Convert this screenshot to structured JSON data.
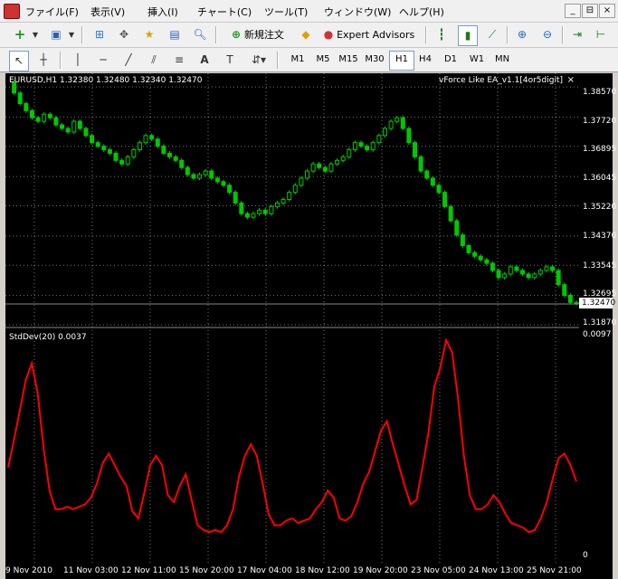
{
  "menu": [
    "ファイル(F)",
    "表示(V)",
    "挿入(I)",
    "チャート(C)",
    "ツール(T)",
    "ウィンドウ(W)",
    "ヘルプ(H)"
  ],
  "window_buttons": [
    "_",
    "⊟",
    "×"
  ],
  "toolbar": {
    "new_order": "新規注文",
    "expert_advisors": "Expert Advisors"
  },
  "timeframes": [
    "M1",
    "M5",
    "M15",
    "M30",
    "H1",
    "H4",
    "D1",
    "W1",
    "MN"
  ],
  "active_timeframe": "H1",
  "chart": {
    "header": "EURUSD,H1  1.32380 1.32480 1.32340 1.32470",
    "ea_label": "vForce Like EA_v1.1[4or5digit]",
    "ea_close": "×",
    "current_price": "1.32470",
    "price_axis": [
      "1.38570",
      "1.37720",
      "1.36895",
      "1.36045",
      "1.35220",
      "1.34370",
      "1.33545",
      "1.32695",
      "1.31870"
    ],
    "indicator_label": "StdDev(20) 0.0037",
    "indicator_axis": [
      "0.0097",
      "0"
    ],
    "time_axis": [
      "9 Nov 2010",
      "11 Nov 03:00",
      "12 Nov 11:00",
      "15 Nov 20:00",
      "17 Nov 04:00",
      "18 Nov 12:00",
      "19 Nov 20:00",
      "23 Nov 05:00",
      "24 Nov 13:00",
      "25 Nov 21:00"
    ],
    "colors": {
      "candle": "#00c800",
      "indicator": "#ff0000",
      "grid": "#ffffff",
      "background": "#000000"
    }
  },
  "chart_data": {
    "type": "line",
    "title": "EURUSD,H1",
    "series": [
      {
        "name": "EURUSD",
        "values": [
          1.387,
          1.384,
          1.381,
          1.379,
          1.377,
          1.376,
          1.378,
          1.377,
          1.375,
          1.374,
          1.373,
          1.376,
          1.374,
          1.372,
          1.37,
          1.369,
          1.368,
          1.367,
          1.365,
          1.364,
          1.366,
          1.368,
          1.37,
          1.372,
          1.371,
          1.369,
          1.367,
          1.366,
          1.365,
          1.363,
          1.361,
          1.36,
          1.361,
          1.362,
          1.36,
          1.359,
          1.358,
          1.356,
          1.353,
          1.35,
          1.349,
          1.35,
          1.351,
          1.35,
          1.352,
          1.353,
          1.354,
          1.356,
          1.358,
          1.36,
          1.362,
          1.364,
          1.363,
          1.362,
          1.364,
          1.365,
          1.366,
          1.368,
          1.37,
          1.369,
          1.368,
          1.37,
          1.372,
          1.374,
          1.376,
          1.377,
          1.374,
          1.37,
          1.366,
          1.362,
          1.36,
          1.358,
          1.356,
          1.352,
          1.348,
          1.344,
          1.341,
          1.339,
          1.338,
          1.337,
          1.336,
          1.334,
          1.332,
          1.333,
          1.335,
          1.334,
          1.333,
          1.332,
          1.333,
          1.334,
          1.335,
          1.334,
          1.33,
          1.327,
          1.325,
          1.3247
        ]
      },
      {
        "name": "StdDev(20)",
        "values": [
          0.004,
          0.0052,
          0.0065,
          0.0078,
          0.0085,
          0.0072,
          0.0048,
          0.003,
          0.0022,
          0.0022,
          0.0023,
          0.0022,
          0.0023,
          0.0024,
          0.0027,
          0.0033,
          0.0042,
          0.0046,
          0.0041,
          0.0036,
          0.0032,
          0.0021,
          0.0018,
          0.0029,
          0.0041,
          0.0045,
          0.0041,
          0.0028,
          0.0025,
          0.0032,
          0.0037,
          0.0026,
          0.0015,
          0.0013,
          0.0012,
          0.0013,
          0.0012,
          0.0015,
          0.0022,
          0.0036,
          0.0045,
          0.005,
          0.0045,
          0.0033,
          0.002,
          0.0015,
          0.0015,
          0.0017,
          0.0018,
          0.0016,
          0.0017,
          0.0018,
          0.0022,
          0.0025,
          0.003,
          0.0027,
          0.0018,
          0.0017,
          0.0019,
          0.0025,
          0.0033,
          0.0038,
          0.0047,
          0.0056,
          0.006,
          0.005,
          0.0041,
          0.0032,
          0.0024,
          0.0026,
          0.004,
          0.0055,
          0.0075,
          0.0083,
          0.0095,
          0.009,
          0.007,
          0.0045,
          0.0028,
          0.0022,
          0.0022,
          0.0024,
          0.0028,
          0.0025,
          0.002,
          0.0016,
          0.0015,
          0.0014,
          0.0012,
          0.0013,
          0.0018,
          0.0025,
          0.0035,
          0.0044,
          0.0046,
          0.0041,
          0.0034
        ]
      }
    ],
    "ylim_price": [
      1.3187,
      1.3875
    ],
    "ylim_indicator": [
      0,
      0.0097
    ],
    "grid": true
  }
}
